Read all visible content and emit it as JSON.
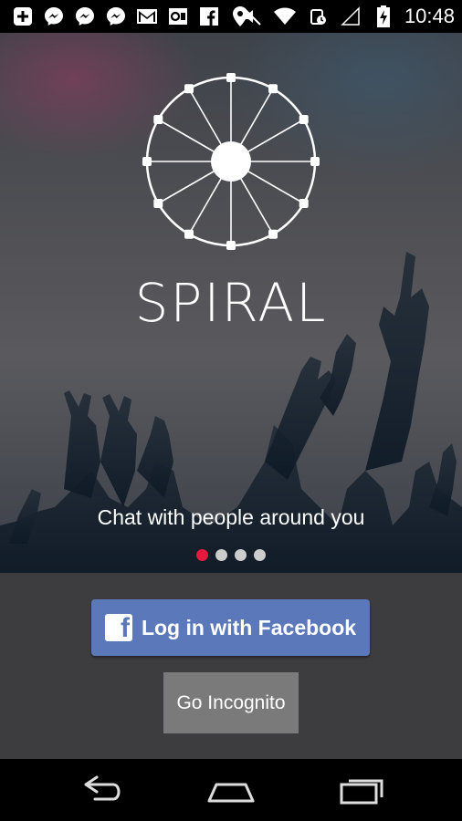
{
  "status_bar": {
    "time": "10:48",
    "left_icons": [
      "add-box-icon",
      "messenger-icon",
      "messenger-icon",
      "messenger-icon",
      "gmail-icon",
      "outlook-icon",
      "facebook-icon",
      "location-pin-icon"
    ],
    "right_icons": [
      "mute-icon",
      "wifi-icon",
      "sync-icon",
      "signal-icon",
      "battery-charging-icon"
    ]
  },
  "hero": {
    "brand": "SPIRAL",
    "tagline": "Chat with people around you",
    "pager": {
      "count": 4,
      "active_index": 0,
      "active_color": "#e5183e",
      "inactive_color": "#cccccc"
    }
  },
  "actions": {
    "facebook_login": "Log in with Facebook",
    "facebook_color": "#5b78bb",
    "incognito": "Go Incognito"
  },
  "nav_bar": {
    "buttons": [
      "back-icon",
      "home-icon",
      "recent-apps-icon"
    ]
  }
}
